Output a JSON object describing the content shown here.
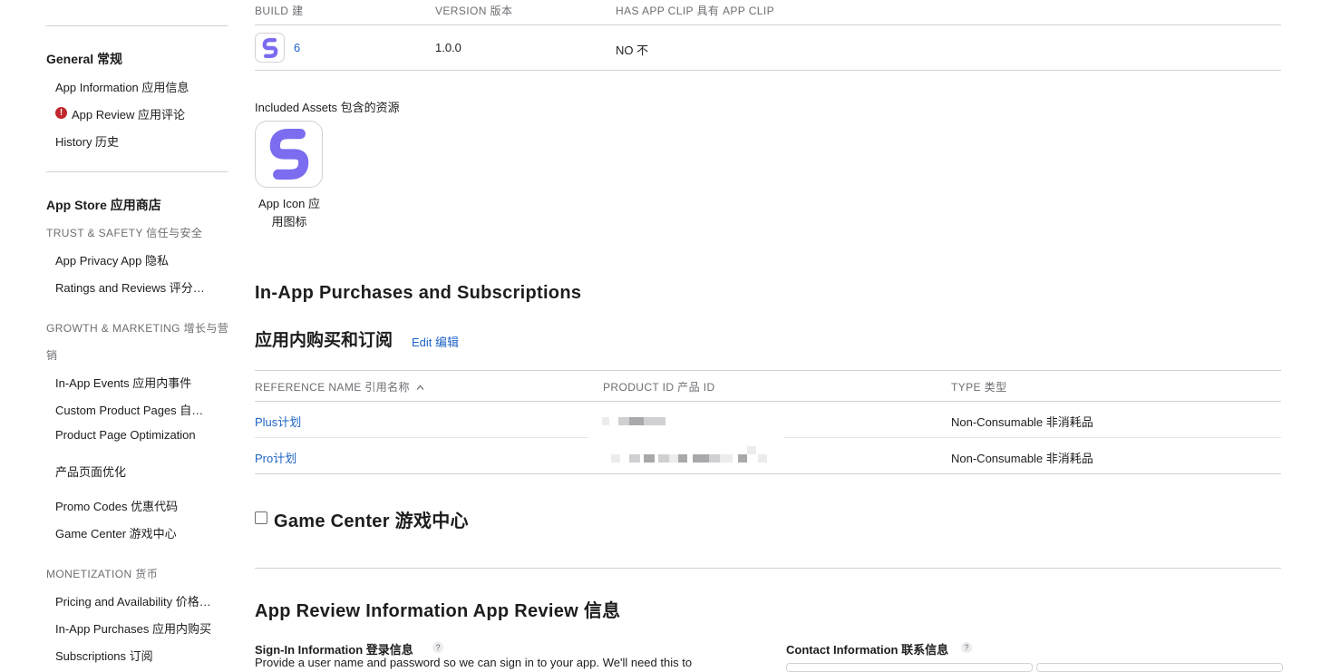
{
  "sidebar": {
    "general": {
      "title": "General  常规",
      "items": [
        {
          "label": "App Information  应用信息"
        },
        {
          "label": "App Review  应用评论",
          "alert": "!"
        },
        {
          "label": "History  历史"
        }
      ]
    },
    "app_store": {
      "title": "App Store  应用商店",
      "trust_safety": {
        "title": "TRUST & SAFETY  信任与安全",
        "items": [
          {
            "label": "App Privacy  App 隐私"
          },
          {
            "label": "Ratings and Reviews  评分…"
          }
        ]
      },
      "growth": {
        "title_line1": "GROWTH & MARKETING  增长与营",
        "title_line2": "销",
        "items": [
          {
            "label": "In-App Events  应用内事件"
          },
          {
            "label": "Custom Product Pages  自…"
          },
          {
            "label": "Product Page Optimization"
          },
          {
            "label": "产品页面优化"
          },
          {
            "label": "Promo Codes  优惠代码"
          },
          {
            "label": "Game Center  游戏中心"
          }
        ]
      },
      "monetization": {
        "title": "MONETIZATION  货币",
        "items": [
          {
            "label": "Pricing and Availability  价格…"
          },
          {
            "label": "In-App Purchases  应用内购买"
          },
          {
            "label": "Subscriptions  订阅"
          }
        ]
      }
    }
  },
  "build_table": {
    "headers": {
      "build": "BUILD  建",
      "version": "VERSION  版本",
      "app_clip": "HAS APP CLIP  具有 APP CLIP"
    },
    "row": {
      "build": "6",
      "version": "1.0.0",
      "app_clip": "NO  不"
    }
  },
  "included_assets": {
    "title": "Included Assets  包含的资源",
    "app_icon_line1": "App Icon  应",
    "app_icon_line2": "用图标"
  },
  "iap": {
    "title": "In-App Purchases and Subscriptions",
    "title_cn": "应用内购买和订阅",
    "edit": "Edit  编辑",
    "headers": {
      "ref": "REFERENCE NAME  引用名称",
      "sort_icon": "chevron-up-icon",
      "product_id": "PRODUCT ID  产品 ID",
      "type": "TYPE  类型"
    },
    "rows": [
      {
        "ref": "Plus计划",
        "type": "Non-Consumable  非消耗品"
      },
      {
        "ref": "Pro计划",
        "type": "Non-Consumable  非消耗品"
      }
    ]
  },
  "game_center": {
    "label": "Game Center  游戏中心",
    "checked": false
  },
  "app_review_info": {
    "title": "App Review Information  App Review 信息",
    "sign_in": {
      "title": "Sign-In Information  登录信息",
      "desc": "Provide a user name and password so we can sign in to your app. We'll need this to"
    },
    "contact": {
      "title": "Contact Information  联系信息"
    },
    "help": "?"
  },
  "colors": {
    "link": "#2064c4",
    "alert": "#c1272d",
    "icon_purple": "#7b6cf0"
  }
}
